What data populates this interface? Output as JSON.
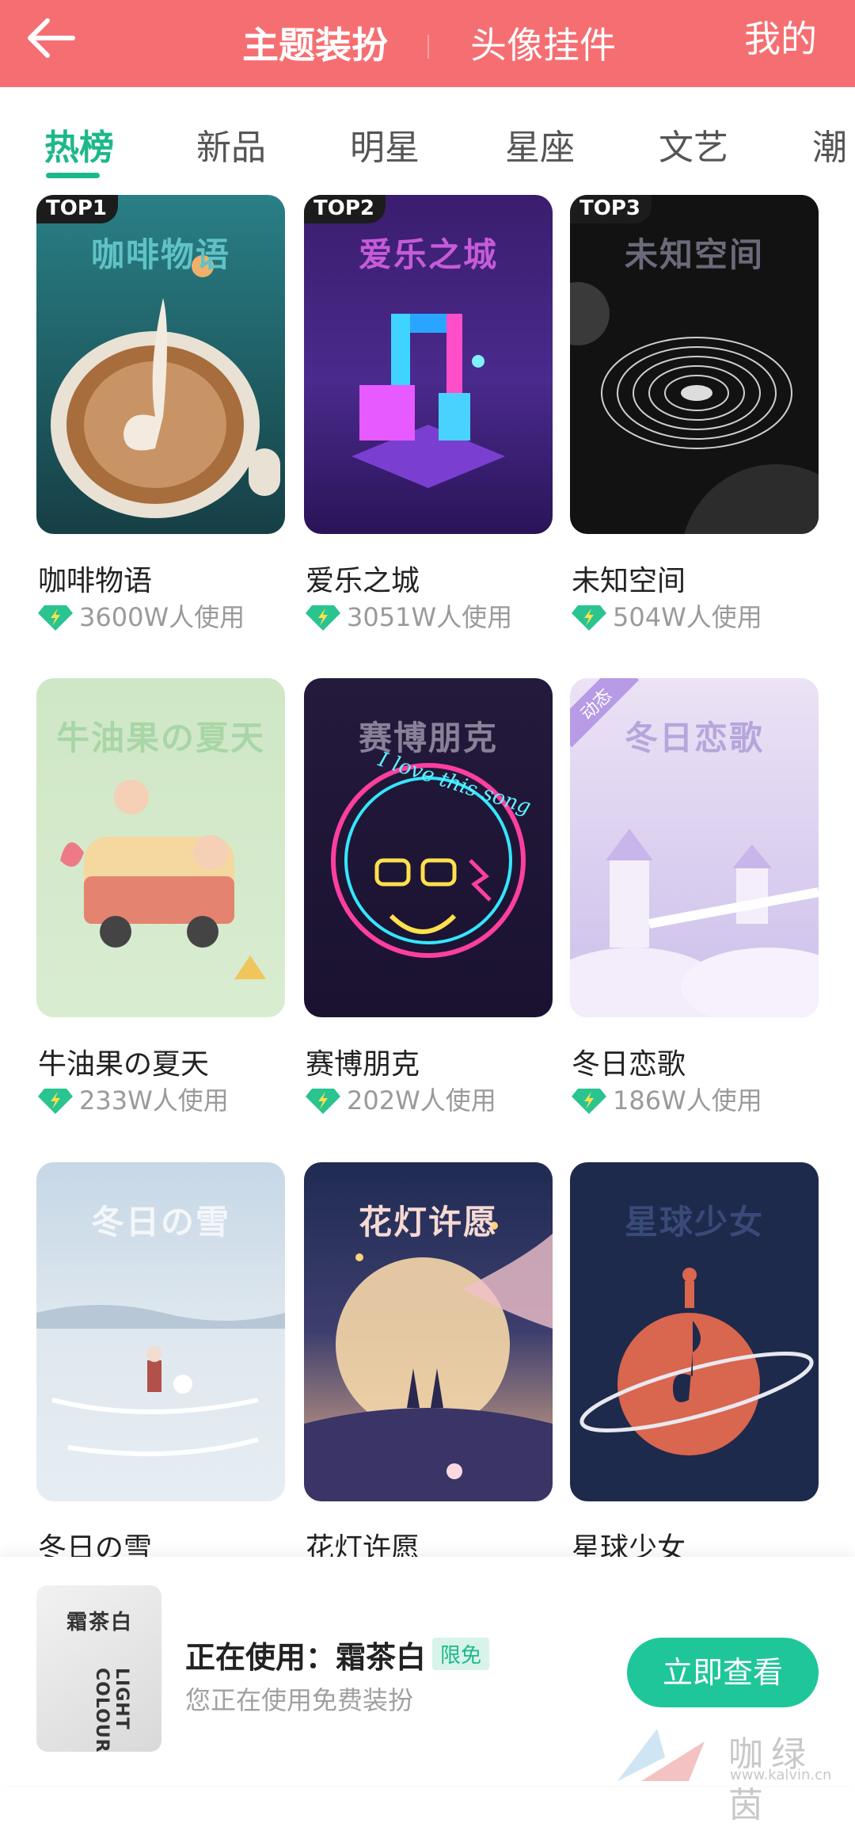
{
  "header": {
    "tabs": [
      {
        "label": "主题装扮",
        "active": true
      },
      {
        "label": "头像挂件",
        "active": false
      }
    ],
    "right_label": "我的",
    "background": "#f56f72"
  },
  "categories": [
    "热榜",
    "新品",
    "明星",
    "星座",
    "文艺",
    "潮"
  ],
  "active_category": "热榜",
  "accent": "#1db88a",
  "themes": [
    {
      "rank": "TOP1",
      "thumb_title": "咖啡物语",
      "name": "咖啡物语",
      "usage": "3600W人使用"
    },
    {
      "rank": "TOP2",
      "thumb_title": "爱乐之城",
      "name": "爱乐之城",
      "usage": "3051W人使用"
    },
    {
      "rank": "TOP3",
      "thumb_title": "未知空间",
      "name": "未知空间",
      "usage": "504W人使用"
    },
    {
      "thumb_title": "牛油果の夏天",
      "name": "牛油果の夏天",
      "usage": "233W人使用"
    },
    {
      "thumb_title": "赛博朋克",
      "thumb_neon": "I love this song",
      "name": "赛博朋克",
      "usage": "202W人使用"
    },
    {
      "tag": "动态",
      "thumb_title": "冬日恋歌",
      "name": "冬日恋歌",
      "usage": "186W人使用"
    },
    {
      "thumb_title": "冬日の雪",
      "name": "冬日の雪"
    },
    {
      "thumb_title": "花灯许愿",
      "name": "花灯许愿"
    },
    {
      "thumb_title": "星球少女",
      "name": "星球少女"
    }
  ],
  "current": {
    "thumb_title": "霜茶白",
    "thumb_sub": "LIGHT COLOUR.",
    "label": "正在使用：霜茶白",
    "badge": "限免",
    "subtitle": "您正在使用免费装扮",
    "button": "立即查看"
  },
  "watermark": {
    "text": "咖绿茵",
    "url": "www.kalvin.cn"
  }
}
